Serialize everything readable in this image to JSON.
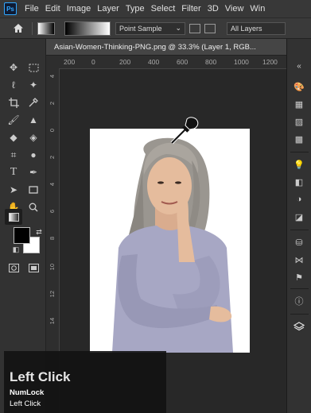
{
  "menubar": {
    "logo": "Ps",
    "items": [
      "File",
      "Edit",
      "Image",
      "Layer",
      "Type",
      "Select",
      "Filter",
      "3D",
      "View",
      "Win"
    ]
  },
  "options": {
    "home_icon": "home-icon",
    "sample_mode": "Point Sample",
    "layers_mode": "All Layers"
  },
  "document": {
    "tab_title": "Asian-Women-Thinking-PNG.png @ 33.3% (Layer 1, RGB...",
    "ruler_top": [
      "200",
      "0",
      "200",
      "400",
      "600",
      "800",
      "1000",
      "1200"
    ],
    "ruler_left": [
      "4",
      "2",
      "0",
      "2",
      "4",
      "6",
      "8",
      "10",
      "12",
      "14"
    ]
  },
  "colors": {
    "foreground": "#000000",
    "background": "#ffffff",
    "accent": "#31a8ff"
  },
  "overlay": {
    "title": "Left Click",
    "line1": "NumLock",
    "line2": "Left Click"
  }
}
